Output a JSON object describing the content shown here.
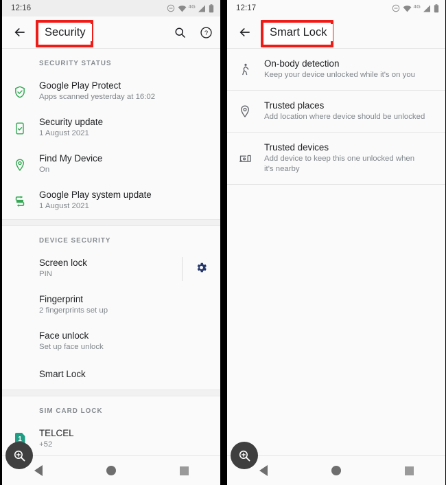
{
  "colors": {
    "highlight": "#ee1b16",
    "green_icon": "#34a853",
    "gear_blue": "#26386b",
    "sim_teal": "#1f9e85",
    "panel_bg": "#fafafa",
    "text_primary": "#202124",
    "text_secondary": "#80868b"
  },
  "left": {
    "status": {
      "time": "12:16",
      "icons": [
        "do-not-disturb-icon",
        "wifi-icon",
        "signal-icon",
        "battery-icon"
      ],
      "network_label": "4G"
    },
    "appbar": {
      "back_label": "Back",
      "title": "Security",
      "title_highlighted": true,
      "actions": [
        "search-icon",
        "help-icon"
      ]
    },
    "sections": [
      {
        "header": "SECURITY STATUS",
        "rows": [
          {
            "icon": "shield-check-icon",
            "title": "Google Play Protect",
            "subtitle": "Apps scanned yesterday at 16:02"
          },
          {
            "icon": "phone-check-icon",
            "title": "Security update",
            "subtitle": "1 August 2021"
          },
          {
            "icon": "location-pin-icon",
            "title": "Find My Device",
            "subtitle": "On"
          },
          {
            "icon": "system-update-icon",
            "title": "Google Play system update",
            "subtitle": "1 August 2021"
          }
        ]
      },
      {
        "header": "DEVICE SECURITY",
        "rows": [
          {
            "icon": "",
            "title": "Screen lock",
            "subtitle": "PIN",
            "trailing_icon": "gear-icon"
          },
          {
            "icon": "",
            "title": "Fingerprint",
            "subtitle": "2 fingerprints set up"
          },
          {
            "icon": "",
            "title": "Face unlock",
            "subtitle": "Set up face unlock"
          },
          {
            "icon": "",
            "title": "Smart Lock",
            "subtitle": ""
          }
        ]
      },
      {
        "header": "SIM CARD LOCK",
        "rows": [
          {
            "icon": "sim-card-icon",
            "icon_text": "1",
            "title": "TELCEL",
            "subtitle": "+52"
          }
        ]
      }
    ],
    "fab": "accessibility-magnifier-icon",
    "nav": [
      "back-nav-button",
      "home-nav-button",
      "recents-nav-button"
    ]
  },
  "right": {
    "status": {
      "time": "12:17",
      "icons": [
        "do-not-disturb-icon",
        "wifi-icon",
        "signal-icon",
        "battery-icon"
      ],
      "network_label": "4G"
    },
    "appbar": {
      "back_label": "Back",
      "title": "Smart Lock",
      "title_highlighted": true,
      "actions": []
    },
    "rows": [
      {
        "icon": "walking-person-icon",
        "title": "On-body detection",
        "subtitle": "Keep your device unlocked while it's on you"
      },
      {
        "icon": "location-pin-icon",
        "title": "Trusted places",
        "subtitle": "Add location where device should be unlocked"
      },
      {
        "icon": "devices-icon",
        "title": "Trusted devices",
        "subtitle": "Add device to keep this one unlocked when it's nearby"
      }
    ],
    "fab": "accessibility-magnifier-icon",
    "nav": [
      "back-nav-button",
      "home-nav-button",
      "recents-nav-button"
    ]
  }
}
